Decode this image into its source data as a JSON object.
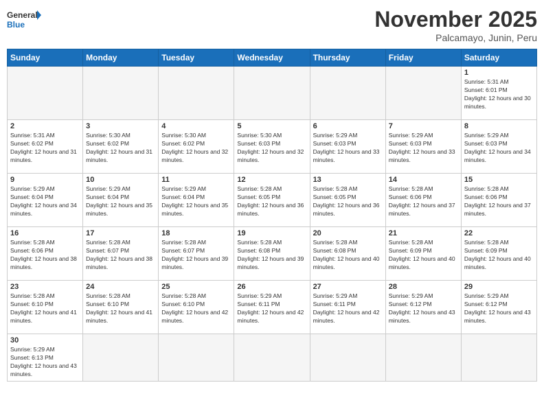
{
  "logo": {
    "text_general": "General",
    "text_blue": "Blue"
  },
  "header": {
    "month": "November 2025",
    "location": "Palcamayo, Junin, Peru"
  },
  "days_of_week": [
    "Sunday",
    "Monday",
    "Tuesday",
    "Wednesday",
    "Thursday",
    "Friday",
    "Saturday"
  ],
  "weeks": [
    [
      {
        "day": "",
        "info": ""
      },
      {
        "day": "",
        "info": ""
      },
      {
        "day": "",
        "info": ""
      },
      {
        "day": "",
        "info": ""
      },
      {
        "day": "",
        "info": ""
      },
      {
        "day": "",
        "info": ""
      },
      {
        "day": "1",
        "info": "Sunrise: 5:31 AM\nSunset: 6:01 PM\nDaylight: 12 hours and 30 minutes."
      }
    ],
    [
      {
        "day": "2",
        "info": "Sunrise: 5:31 AM\nSunset: 6:02 PM\nDaylight: 12 hours and 31 minutes."
      },
      {
        "day": "3",
        "info": "Sunrise: 5:30 AM\nSunset: 6:02 PM\nDaylight: 12 hours and 31 minutes."
      },
      {
        "day": "4",
        "info": "Sunrise: 5:30 AM\nSunset: 6:02 PM\nDaylight: 12 hours and 32 minutes."
      },
      {
        "day": "5",
        "info": "Sunrise: 5:30 AM\nSunset: 6:03 PM\nDaylight: 12 hours and 32 minutes."
      },
      {
        "day": "6",
        "info": "Sunrise: 5:29 AM\nSunset: 6:03 PM\nDaylight: 12 hours and 33 minutes."
      },
      {
        "day": "7",
        "info": "Sunrise: 5:29 AM\nSunset: 6:03 PM\nDaylight: 12 hours and 33 minutes."
      },
      {
        "day": "8",
        "info": "Sunrise: 5:29 AM\nSunset: 6:03 PM\nDaylight: 12 hours and 34 minutes."
      }
    ],
    [
      {
        "day": "9",
        "info": "Sunrise: 5:29 AM\nSunset: 6:04 PM\nDaylight: 12 hours and 34 minutes."
      },
      {
        "day": "10",
        "info": "Sunrise: 5:29 AM\nSunset: 6:04 PM\nDaylight: 12 hours and 35 minutes."
      },
      {
        "day": "11",
        "info": "Sunrise: 5:29 AM\nSunset: 6:04 PM\nDaylight: 12 hours and 35 minutes."
      },
      {
        "day": "12",
        "info": "Sunrise: 5:28 AM\nSunset: 6:05 PM\nDaylight: 12 hours and 36 minutes."
      },
      {
        "day": "13",
        "info": "Sunrise: 5:28 AM\nSunset: 6:05 PM\nDaylight: 12 hours and 36 minutes."
      },
      {
        "day": "14",
        "info": "Sunrise: 5:28 AM\nSunset: 6:06 PM\nDaylight: 12 hours and 37 minutes."
      },
      {
        "day": "15",
        "info": "Sunrise: 5:28 AM\nSunset: 6:06 PM\nDaylight: 12 hours and 37 minutes."
      }
    ],
    [
      {
        "day": "16",
        "info": "Sunrise: 5:28 AM\nSunset: 6:06 PM\nDaylight: 12 hours and 38 minutes."
      },
      {
        "day": "17",
        "info": "Sunrise: 5:28 AM\nSunset: 6:07 PM\nDaylight: 12 hours and 38 minutes."
      },
      {
        "day": "18",
        "info": "Sunrise: 5:28 AM\nSunset: 6:07 PM\nDaylight: 12 hours and 39 minutes."
      },
      {
        "day": "19",
        "info": "Sunrise: 5:28 AM\nSunset: 6:08 PM\nDaylight: 12 hours and 39 minutes."
      },
      {
        "day": "20",
        "info": "Sunrise: 5:28 AM\nSunset: 6:08 PM\nDaylight: 12 hours and 40 minutes."
      },
      {
        "day": "21",
        "info": "Sunrise: 5:28 AM\nSunset: 6:09 PM\nDaylight: 12 hours and 40 minutes."
      },
      {
        "day": "22",
        "info": "Sunrise: 5:28 AM\nSunset: 6:09 PM\nDaylight: 12 hours and 40 minutes."
      }
    ],
    [
      {
        "day": "23",
        "info": "Sunrise: 5:28 AM\nSunset: 6:10 PM\nDaylight: 12 hours and 41 minutes."
      },
      {
        "day": "24",
        "info": "Sunrise: 5:28 AM\nSunset: 6:10 PM\nDaylight: 12 hours and 41 minutes."
      },
      {
        "day": "25",
        "info": "Sunrise: 5:28 AM\nSunset: 6:10 PM\nDaylight: 12 hours and 42 minutes."
      },
      {
        "day": "26",
        "info": "Sunrise: 5:29 AM\nSunset: 6:11 PM\nDaylight: 12 hours and 42 minutes."
      },
      {
        "day": "27",
        "info": "Sunrise: 5:29 AM\nSunset: 6:11 PM\nDaylight: 12 hours and 42 minutes."
      },
      {
        "day": "28",
        "info": "Sunrise: 5:29 AM\nSunset: 6:12 PM\nDaylight: 12 hours and 43 minutes."
      },
      {
        "day": "29",
        "info": "Sunrise: 5:29 AM\nSunset: 6:12 PM\nDaylight: 12 hours and 43 minutes."
      }
    ],
    [
      {
        "day": "30",
        "info": "Sunrise: 5:29 AM\nSunset: 6:13 PM\nDaylight: 12 hours and 43 minutes."
      },
      {
        "day": "",
        "info": ""
      },
      {
        "day": "",
        "info": ""
      },
      {
        "day": "",
        "info": ""
      },
      {
        "day": "",
        "info": ""
      },
      {
        "day": "",
        "info": ""
      },
      {
        "day": "",
        "info": ""
      }
    ]
  ]
}
